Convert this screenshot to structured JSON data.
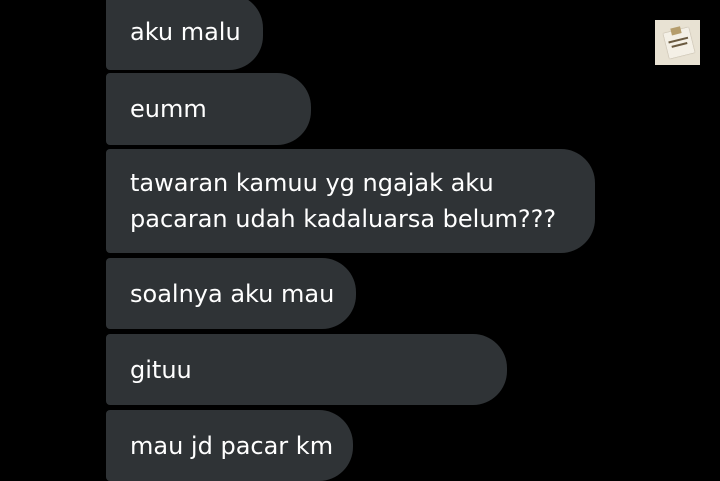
{
  "messages": [
    {
      "lines": [
        "aku malu"
      ]
    },
    {
      "lines": [
        "eumm"
      ]
    },
    {
      "lines": [
        "tawaran kamuu yg ngajak aku",
        "pacaran udah kadaluarsa belum???"
      ]
    },
    {
      "lines": [
        "soalnya aku mau"
      ]
    },
    {
      "lines": [
        "gituu"
      ]
    },
    {
      "lines": [
        "mau jd pacar km"
      ]
    }
  ],
  "colors": {
    "background": "#000000",
    "bubble": "#2f3336",
    "text": "#ffffff"
  },
  "avatar": {
    "icon": "profile-picture-icon"
  }
}
